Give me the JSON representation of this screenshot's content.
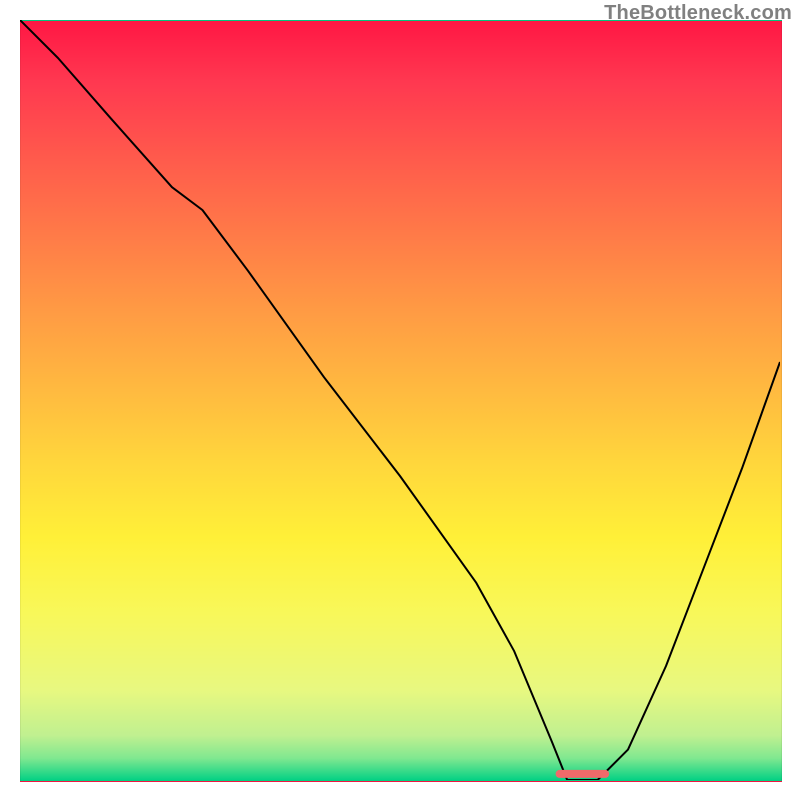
{
  "watermark": "TheBottleneck.com",
  "chart_data": {
    "type": "line",
    "title": "",
    "xlabel": "",
    "ylabel": "",
    "xlim": [
      0,
      100
    ],
    "ylim": [
      0,
      100
    ],
    "series": [
      {
        "name": "curve",
        "x": [
          0,
          5,
          12,
          20,
          24,
          30,
          40,
          50,
          60,
          65,
          70,
          72,
          76,
          80,
          85,
          90,
          95,
          100
        ],
        "values": [
          100,
          95,
          87,
          78,
          75,
          67,
          53,
          40,
          26,
          17,
          5,
          0,
          0,
          4,
          15,
          28,
          41,
          55
        ]
      }
    ],
    "flat_region": {
      "x_start": 72,
      "x_end": 76,
      "y": 0
    },
    "marker": {
      "x_center": 74,
      "y": 0.8,
      "width": 6
    },
    "gradient_stops": [
      {
        "offset": 0,
        "color": "#ff1744"
      },
      {
        "offset": 8,
        "color": "#ff3850"
      },
      {
        "offset": 18,
        "color": "#ff5a4c"
      },
      {
        "offset": 28,
        "color": "#ff7a48"
      },
      {
        "offset": 38,
        "color": "#ff9a44"
      },
      {
        "offset": 48,
        "color": "#ffb840"
      },
      {
        "offset": 58,
        "color": "#ffd63c"
      },
      {
        "offset": 68,
        "color": "#fff038"
      },
      {
        "offset": 78,
        "color": "#f8f85a"
      },
      {
        "offset": 88,
        "color": "#e8f880"
      },
      {
        "offset": 94,
        "color": "#c0f090"
      },
      {
        "offset": 97,
        "color": "#80e890"
      },
      {
        "offset": 100,
        "color": "#00d084"
      }
    ]
  }
}
